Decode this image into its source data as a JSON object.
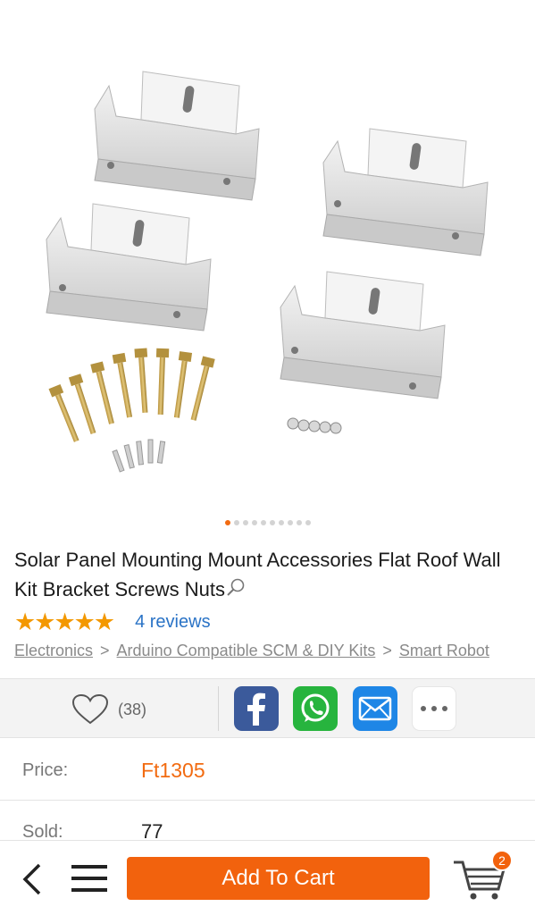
{
  "product": {
    "image_alt": "",
    "gallery_total": 10,
    "gallery_active": 0,
    "title": "Solar Panel Mounting Mount Accessories Flat Roof  Wall Kit Bracket Screws Nuts",
    "rating_stars": 5,
    "reviews_label": "4 reviews"
  },
  "breadcrumb": [
    {
      "label": "Electronics"
    },
    {
      "label": "Arduino Compatible SCM & DIY Kits"
    },
    {
      "label": "Smart Robot"
    }
  ],
  "breadcrumb_separator": ">",
  "share": {
    "favorite_count": "(38)",
    "buttons": [
      "facebook-icon",
      "whatsapp-icon",
      "mail-icon",
      "more-icon"
    ]
  },
  "details": {
    "price_label": "Price:",
    "price_value": "Ft1305",
    "sold_label": "Sold:",
    "sold_value": "77"
  },
  "bottom_bar": {
    "add_to_cart": "Add To Cart",
    "cart_count": "2"
  },
  "colors": {
    "accent": "#f2620d",
    "link": "#2a73c6",
    "star": "#f39800"
  }
}
